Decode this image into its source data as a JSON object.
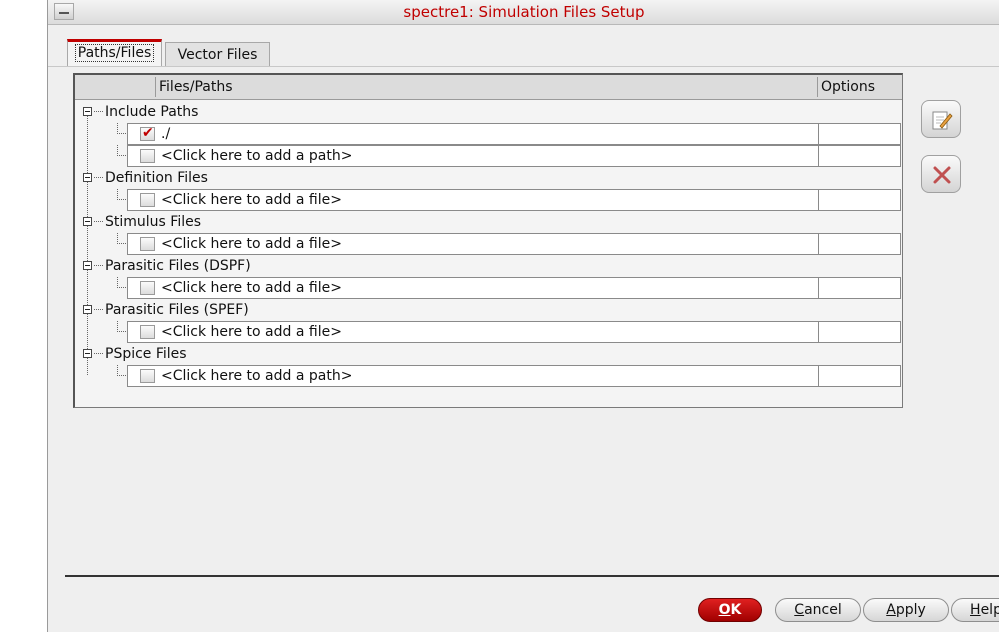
{
  "window": {
    "title": "spectre1: Simulation Files Setup"
  },
  "tabs": [
    {
      "label": "Paths/Files",
      "active": true
    },
    {
      "label": "Vector Files",
      "active": false
    }
  ],
  "table": {
    "columns": [
      "Files/Paths",
      "Options"
    ],
    "groups": [
      {
        "label": "Include Paths",
        "items": [
          {
            "text": "./",
            "checked": true
          },
          {
            "text": "<Click here to add a path>",
            "checked": false
          }
        ]
      },
      {
        "label": "Definition Files",
        "items": [
          {
            "text": "<Click here to add a file>",
            "checked": false
          }
        ]
      },
      {
        "label": "Stimulus Files",
        "items": [
          {
            "text": "<Click here to add a file>",
            "checked": false
          }
        ]
      },
      {
        "label": "Parasitic Files (DSPF)",
        "items": [
          {
            "text": "<Click here to add a file>",
            "checked": false
          }
        ]
      },
      {
        "label": "Parasitic Files (SPEF)",
        "items": [
          {
            "text": "<Click here to add a file>",
            "checked": false
          }
        ]
      },
      {
        "label": "PSpice Files",
        "items": [
          {
            "text": "<Click here to add a path>",
            "checked": false
          }
        ]
      }
    ]
  },
  "side_buttons": [
    {
      "icon": "edit-icon"
    },
    {
      "icon": "delete-icon"
    }
  ],
  "buttons": {
    "ok": {
      "mnemonic": "O",
      "rest": "K"
    },
    "cancel": {
      "mnemonic": "C",
      "rest": "ancel"
    },
    "apply": {
      "mnemonic": "A",
      "rest": "pply"
    },
    "help": {
      "mnemonic": "H",
      "rest": "elp"
    }
  },
  "colors": {
    "accent": "#c00000",
    "checkmark": "#c00000"
  }
}
